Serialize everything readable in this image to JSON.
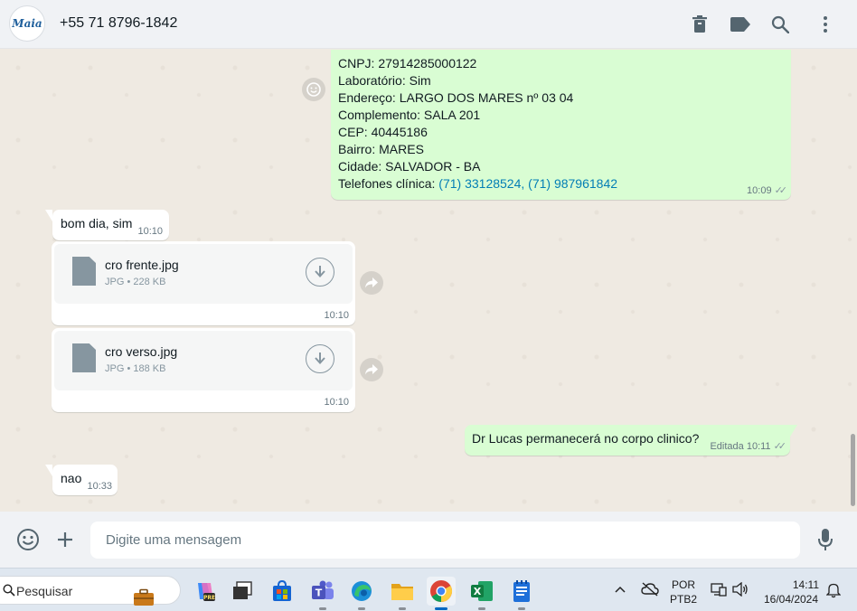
{
  "header": {
    "logo_text": "Maia",
    "contact": "+55 71 8796-1842",
    "icons": [
      "delete-icon",
      "label-icon",
      "search-icon",
      "menu-dots-icon"
    ]
  },
  "messages": {
    "info": {
      "lines": [
        "CNPJ: 27914285000122",
        "Laboratório: Sim",
        "Endereço: LARGO DOS MARES nº 03 04",
        "Complemento: SALA 201",
        "CEP: 40445186",
        "Bairro: MARES",
        "Cidade: SALVADOR - BA"
      ],
      "phones_label": "Telefones clínica: ",
      "phones_link": "(71) 33128524, (71) 987961842",
      "time": "10:09"
    },
    "reply1": {
      "text": "bom dia, sim",
      "time": "10:10"
    },
    "doc1": {
      "name": "cro frente.jpg",
      "meta": "JPG • 228 KB",
      "time": "10:10"
    },
    "doc2": {
      "name": "cro verso.jpg",
      "meta": "JPG • 188 KB",
      "time": "10:10"
    },
    "question": {
      "text": "Dr Lucas permanecerá no corpo clinico?",
      "edited": "Editada",
      "time": "10:11"
    },
    "reply2": {
      "text": "nao",
      "time": "10:33"
    }
  },
  "composer": {
    "placeholder": "Digite uma mensagem",
    "icons": [
      "emoji-icon",
      "plus-icon",
      "mic-icon"
    ]
  },
  "taskbar": {
    "search_label": "Pesquisar",
    "apps": [
      "copilot-icon",
      "task-view-icon",
      "store-icon",
      "teams-icon",
      "edge-icon",
      "file-explorer-icon",
      "chrome-icon",
      "excel-icon",
      "notepad-icon"
    ],
    "lang_top": "POR",
    "lang_bottom": "PTB2",
    "time": "14:11",
    "date": "16/04/2024",
    "accent": "#0067c0"
  },
  "colors": {
    "outgoing_bubble": "#d9fdd3",
    "incoming_bubble": "#ffffff",
    "chat_bg": "#efeae2",
    "link": "#027eb5"
  }
}
